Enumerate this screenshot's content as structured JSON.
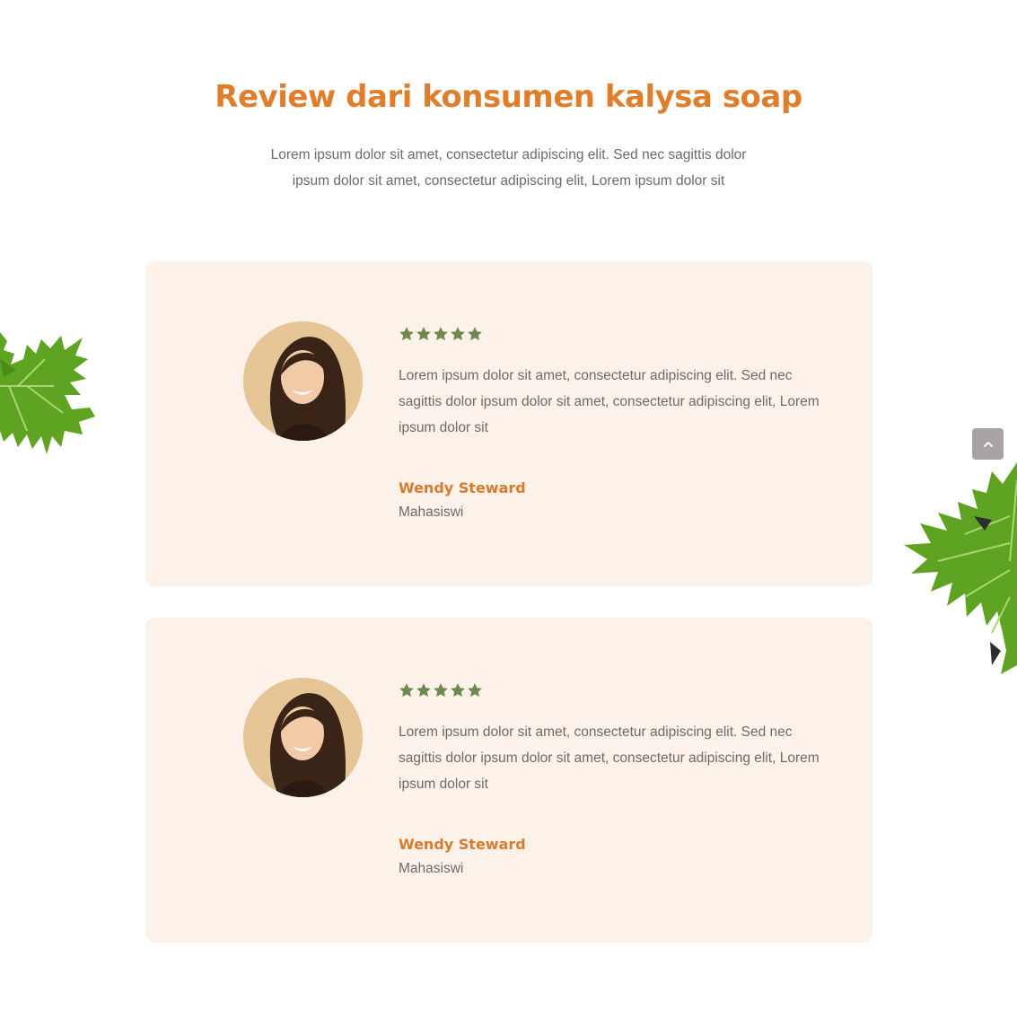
{
  "section": {
    "title": "Review dari konsumen kalysa soap",
    "intro": "Lorem ipsum dolor sit amet, consectetur adipiscing elit. Sed nec sagittis dolor ipsum dolor sit amet, consectetur adipiscing elit, Lorem ipsum dolor sit"
  },
  "reviews": [
    {
      "rating": 5,
      "text": "Lorem ipsum dolor sit amet, consectetur adipiscing elit. Sed nec sagittis dolor ipsum dolor sit amet, consectetur adipiscing elit, Lorem ipsum dolor sit",
      "name": "Wendy Steward",
      "role": "Mahasiswi"
    },
    {
      "rating": 5,
      "text": "Lorem ipsum dolor sit amet, consectetur adipiscing elit. Sed nec sagittis dolor ipsum dolor sit amet, consectetur adipiscing elit, Lorem ipsum dolor sit",
      "name": "Wendy Steward",
      "role": "Mahasiswi"
    }
  ],
  "icons": {
    "star": "star-icon",
    "scroll_top": "chevron-up-icon",
    "decoration": "papaya-leaf-icon"
  },
  "colors": {
    "accent": "#df7f2e",
    "card_bg": "#fdf2ea",
    "star": "#6e8a4e",
    "body_text": "#6f6a66",
    "leaf": "#5fa322"
  }
}
